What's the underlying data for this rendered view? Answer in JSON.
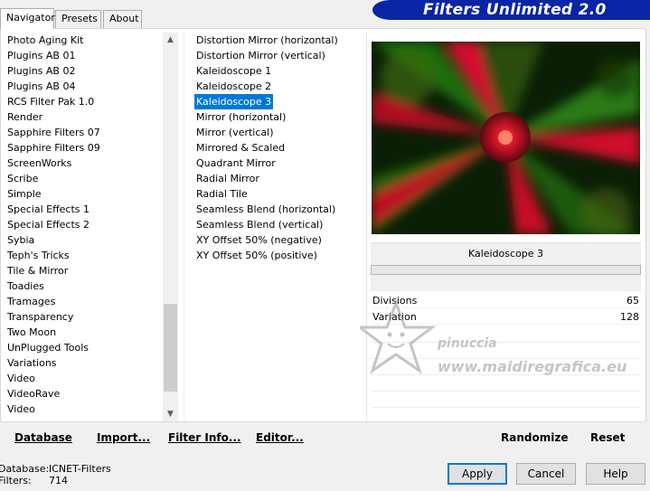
{
  "tabs": [
    {
      "label": "Navigator",
      "active": true
    },
    {
      "label": "Presets",
      "active": false
    },
    {
      "label": "About",
      "active": false
    }
  ],
  "app_title": "Filters Unlimited 2.0",
  "categories": [
    "Photo Aging Kit",
    "Plugins AB 01",
    "Plugins AB 02",
    "Plugins AB 04",
    "RCS Filter Pak 1.0",
    "Render",
    "Sapphire Filters 07",
    "Sapphire Filters 09",
    "ScreenWorks",
    "Scribe",
    "Simple",
    "Special Effects 1",
    "Special Effects 2",
    "Sybia",
    "Teph's Tricks",
    "Tile & Mirror",
    "Toadies",
    "Tramages",
    "Transparency",
    "Two Moon",
    "UnPlugged Tools",
    "Variations",
    "Video",
    "VideoRave",
    "Video"
  ],
  "filters": [
    "Distortion Mirror (horizontal)",
    "Distortion Mirror (vertical)",
    "Kaleidoscope 1",
    "Kaleidoscope 2",
    "Kaleidoscope 3",
    "Mirror (horizontal)",
    "Mirror (vertical)",
    "Mirrored & Scaled",
    "Quadrant Mirror",
    "Radial Mirror",
    "Radial Tile",
    "Seamless Blend (horizontal)",
    "Seamless Blend (vertical)",
    "XY Offset 50% (negative)",
    "XY Offset 50% (positive)"
  ],
  "selected_filter_index": 4,
  "selected_filter_name": "Kaleidoscope 3",
  "params": [
    {
      "name": "Divisions",
      "value": "65"
    },
    {
      "name": "Variation",
      "value": "128"
    }
  ],
  "bottom_links": {
    "database": "Database",
    "import": "Import...",
    "filter_info": "Filter Info...",
    "editor": "Editor...",
    "randomize": "Randomize",
    "reset": "Reset"
  },
  "status": {
    "database_label": "Database:",
    "database_value": "ICNET-Filters",
    "filters_label": "Filters:",
    "filters_value": "714"
  },
  "buttons": {
    "apply": "Apply",
    "cancel": "Cancel",
    "help": "Help"
  },
  "watermark": {
    "line1": "pinuccia",
    "line2": "www.maidiregrafica.eu"
  },
  "colors": {
    "accent": "#0078d7",
    "banner": "#0a24a6"
  }
}
